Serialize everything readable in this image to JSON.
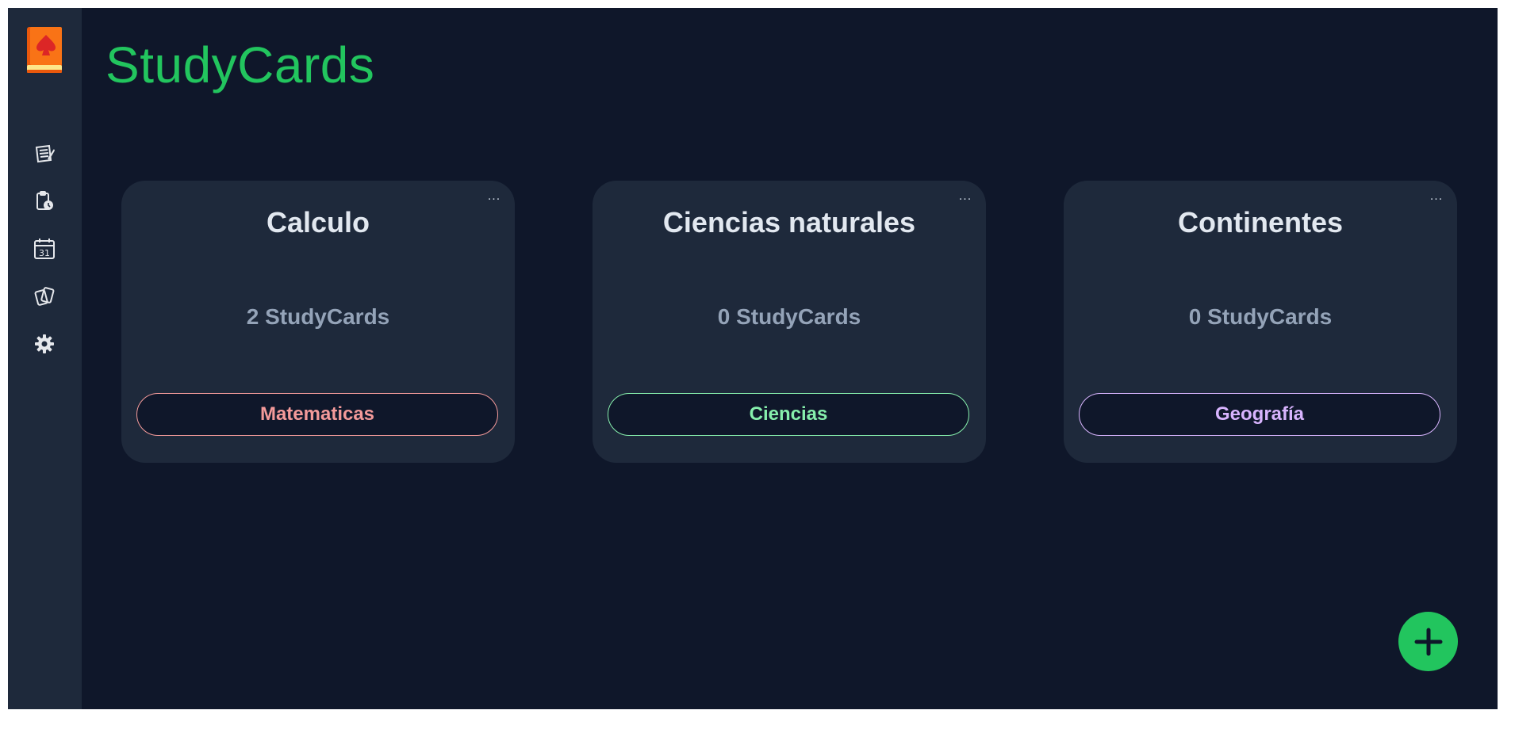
{
  "app": {
    "title": "StudyCards"
  },
  "sidebar": {
    "logo": "spade-book-logo",
    "items": [
      {
        "icon": "notebook-icon"
      },
      {
        "icon": "clipboard-clock-icon"
      },
      {
        "icon": "calendar-icon",
        "label": "31"
      },
      {
        "icon": "cards-icon"
      },
      {
        "icon": "gear-icon"
      }
    ]
  },
  "decks": [
    {
      "title": "Calculo",
      "count": "2 StudyCards",
      "tag": "Matematicas",
      "tag_color": "#f49a9a"
    },
    {
      "title": "Ciencias naturales",
      "count": "0 StudyCards",
      "tag": "Ciencias",
      "tag_color": "#86efac"
    },
    {
      "title": "Continentes",
      "count": "0 StudyCards",
      "tag": "Geografía",
      "tag_color": "#d8b4fe"
    }
  ],
  "card_menu_label": "...",
  "fab": {
    "icon": "plus-icon"
  },
  "colors": {
    "background": "#0f172a",
    "sidebar": "#1e293b",
    "card": "#1e293b",
    "accent": "#22c55e"
  }
}
